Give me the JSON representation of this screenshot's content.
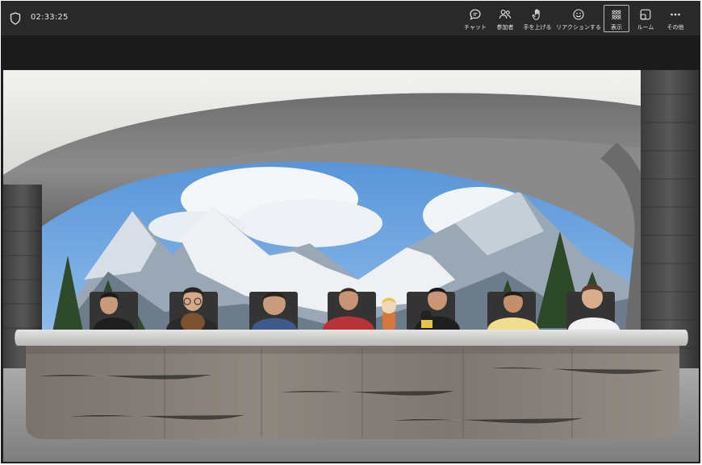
{
  "meeting": {
    "elapsed_time": "02:33:25"
  },
  "toolbar": {
    "chat_label": "チャット",
    "participants_label": "参加者",
    "raise_hand_label": "手を上げる",
    "reactions_label": "リアクションする",
    "view_label": "表示",
    "rooms_label": "ルーム",
    "more_label": "その他"
  },
  "icons": {
    "security": "shield-icon",
    "chat": "chat-bubble-icon",
    "participants": "people-icon",
    "raise_hand": "hand-icon",
    "reactions": "smiley-icon",
    "view": "grid-people-icon",
    "rooms": "rooms-icon",
    "more": "ellipsis-icon"
  },
  "view_mode": "together-mode",
  "participants_count": 7,
  "colors": {
    "toolbar_bg": "#292929",
    "toolbar_text": "#e6e6e6",
    "selected_border": "#bdbdbd"
  }
}
